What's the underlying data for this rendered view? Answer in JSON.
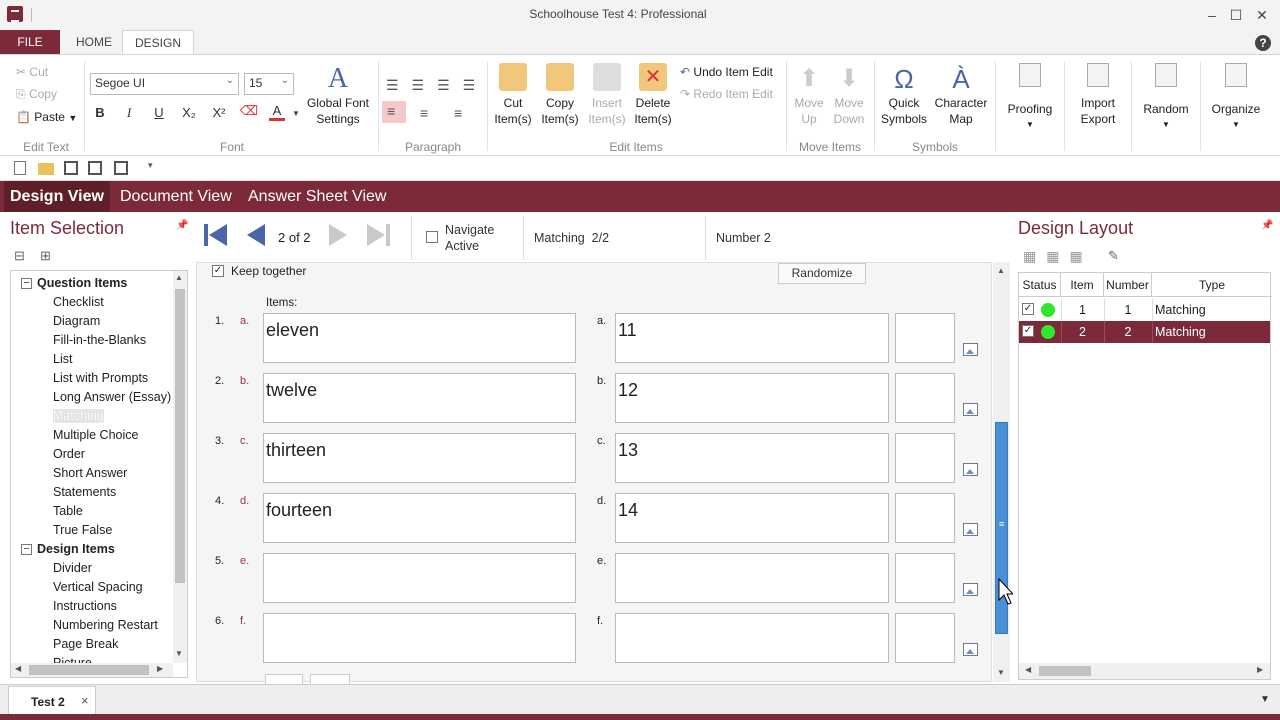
{
  "window": {
    "title": "Schoolhouse Test 4: Professional"
  },
  "ribbon_tabs": {
    "file": "FILE",
    "home": "HOME",
    "design": "DESIGN"
  },
  "help": "?",
  "edit_text": {
    "cut": "Cut",
    "copy": "Copy",
    "paste": "Paste",
    "label": "Edit Text"
  },
  "font": {
    "family": "Segoe UI",
    "size": "15",
    "label": "Font",
    "global": "Global Font Settings",
    "bold": "B",
    "italic": "I",
    "underline": "U",
    "subscript": "X₂",
    "superscript": "X²",
    "font_color": "A"
  },
  "paragraph": {
    "label": "Paragraph"
  },
  "edit_items": {
    "cut": "Cut Item(s)",
    "copy": "Copy Item(s)",
    "insert": "Insert Item(s)",
    "delete": "Delete Item(s)",
    "undo": "Undo Item Edit",
    "redo": "Redo Item Edit",
    "label": "Edit Items"
  },
  "move_items": {
    "up": "Move Up",
    "down": "Move Down",
    "label": "Move Items"
  },
  "symbols": {
    "quick": "Quick Symbols",
    "charmap": "Character Map",
    "label": "Symbols",
    "omega": "Ω",
    "a_grave": "À"
  },
  "proofing": {
    "label": "Proofing"
  },
  "import_export": {
    "label": "Import Export"
  },
  "random": {
    "label": "Random"
  },
  "organize": {
    "label": "Organize"
  },
  "views": {
    "design": "Design View",
    "document": "Document View",
    "answer": "Answer Sheet View"
  },
  "left_panel": {
    "title": "Item Selection",
    "question_header": "Question Items",
    "question_items": [
      "Checklist",
      "Diagram",
      "Fill-in-the-Blanks",
      "List",
      "List with Prompts",
      "Long Answer (Essay)",
      "Matching",
      "Multiple Choice",
      "Order",
      "Short Answer",
      "Statements",
      "Table",
      "True False"
    ],
    "design_header": "Design Items",
    "design_items": [
      "Divider",
      "Vertical Spacing",
      "Instructions",
      "Numbering Restart",
      "Page Break",
      "Picture"
    ]
  },
  "navigator": {
    "page": "2 of 2",
    "navigate_active": "Navigate Active",
    "type": "Matching  2/2",
    "number": "Number 2"
  },
  "editor": {
    "keep_together": "Keep together",
    "randomize": "Randomize",
    "items_label": "Items:",
    "rows": [
      {
        "num": "1.",
        "letter": "a.",
        "left": "eleven",
        "rletter": "a.",
        "right": "11"
      },
      {
        "num": "2.",
        "letter": "b.",
        "left": "twelve",
        "rletter": "b.",
        "right": "12"
      },
      {
        "num": "3.",
        "letter": "c.",
        "left": "thirteen",
        "rletter": "c.",
        "right": "13"
      },
      {
        "num": "4.",
        "letter": "d.",
        "left": "fourteen",
        "rletter": "d.",
        "right": "14"
      },
      {
        "num": "5.",
        "letter": "e.",
        "left": "",
        "rletter": "e.",
        "right": ""
      },
      {
        "num": "6.",
        "letter": "f.",
        "left": "",
        "rletter": "f.",
        "right": ""
      }
    ]
  },
  "right_panel": {
    "title": "Design Layout",
    "columns": [
      "Status",
      "Item",
      "Number",
      "Type"
    ],
    "rows": [
      {
        "item": "1",
        "number": "1",
        "type": "Matching",
        "selected": false
      },
      {
        "item": "2",
        "number": "2",
        "type": "Matching",
        "selected": true
      }
    ]
  },
  "doc_tab": {
    "name": "Test 2",
    "close": "×"
  },
  "colors": {
    "accent": "#7c2a3a",
    "status": "#2ee82e"
  }
}
